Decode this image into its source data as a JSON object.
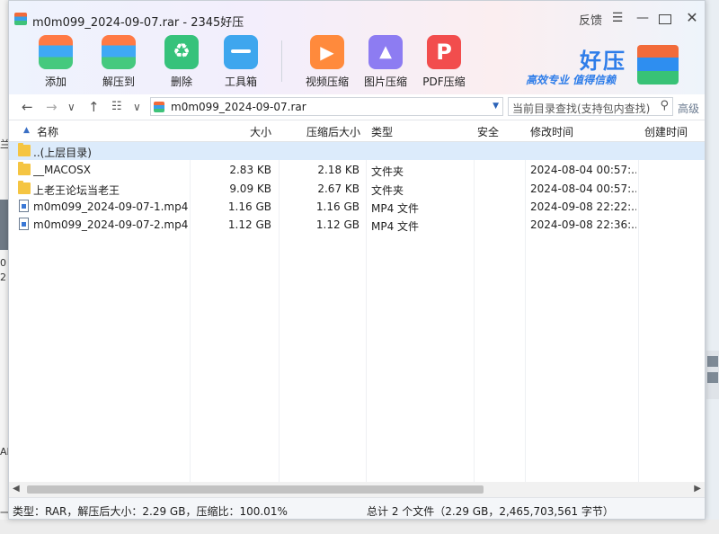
{
  "window": {
    "title": "m0m099_2024-09-07.rar - 2345好压"
  },
  "titlebar": {
    "feedback": "反馈",
    "menu": "☰",
    "minimize": "—",
    "close": "✕"
  },
  "toolbar": [
    {
      "label": "添加",
      "icon": "add-archive-icon"
    },
    {
      "label": "解压到",
      "icon": "extract-icon"
    },
    {
      "label": "删除",
      "icon": "recycle-icon"
    },
    {
      "label": "工具箱",
      "icon": "toolbox-icon"
    },
    {
      "label": "视频压缩",
      "icon": "video-icon"
    },
    {
      "label": "图片压缩",
      "icon": "image-icon"
    },
    {
      "label": "PDF压缩",
      "icon": "pdf-icon"
    }
  ],
  "brand": {
    "name": "好压",
    "slogan": "高效专业  值得信赖"
  },
  "address": {
    "back": "←",
    "forward": "→",
    "history": "∨",
    "up": "↑",
    "view": "☷",
    "view_dd": "∨",
    "path": "m0m099_2024-09-07.rar",
    "search_placeholder": "当前目录查找(支持包内查找)",
    "advanced": "高级"
  },
  "columns": {
    "name": "名称",
    "size": "大小",
    "packed": "压缩后大小",
    "type": "类型",
    "security": "安全",
    "modified": "修改时间",
    "created": "创建时间"
  },
  "files": [
    {
      "name": "..(上层目录)",
      "size": "",
      "packed": "",
      "type": "",
      "modified": "",
      "kind": "folder",
      "selected": true
    },
    {
      "name": "__MACOSX",
      "size": "2.83 KB",
      "packed": "2.18 KB",
      "type": "文件夹",
      "modified": "2024-08-04 00:57:...",
      "kind": "folder"
    },
    {
      "name": "上老王论坛当老王",
      "size": "9.09 KB",
      "packed": "2.67 KB",
      "type": "文件夹",
      "modified": "2024-08-04 00:57:...",
      "kind": "folder"
    },
    {
      "name": "m0m099_2024-09-07-1.mp4 *",
      "size": "1.16 GB",
      "packed": "1.16 GB",
      "type": "MP4 文件",
      "modified": "2024-09-08 22:22:...",
      "kind": "file"
    },
    {
      "name": "m0m099_2024-09-07-2.mp4 *",
      "size": "1.12 GB",
      "packed": "1.12 GB",
      "type": "MP4 文件",
      "modified": "2024-09-08 22:36:...",
      "kind": "file"
    }
  ],
  "status": {
    "left": "类型：RAR，解压后大小：2.29 GB，压缩比：100.01%",
    "right": "总计 2 个文件（2.29 GB，2,465,703,561 字节）"
  },
  "scroll": {
    "left": "◀",
    "right": "▶"
  },
  "background": {
    "left_labels": [
      "兰",
      "0",
      "2",
      "AR",
      "一"
    ]
  }
}
